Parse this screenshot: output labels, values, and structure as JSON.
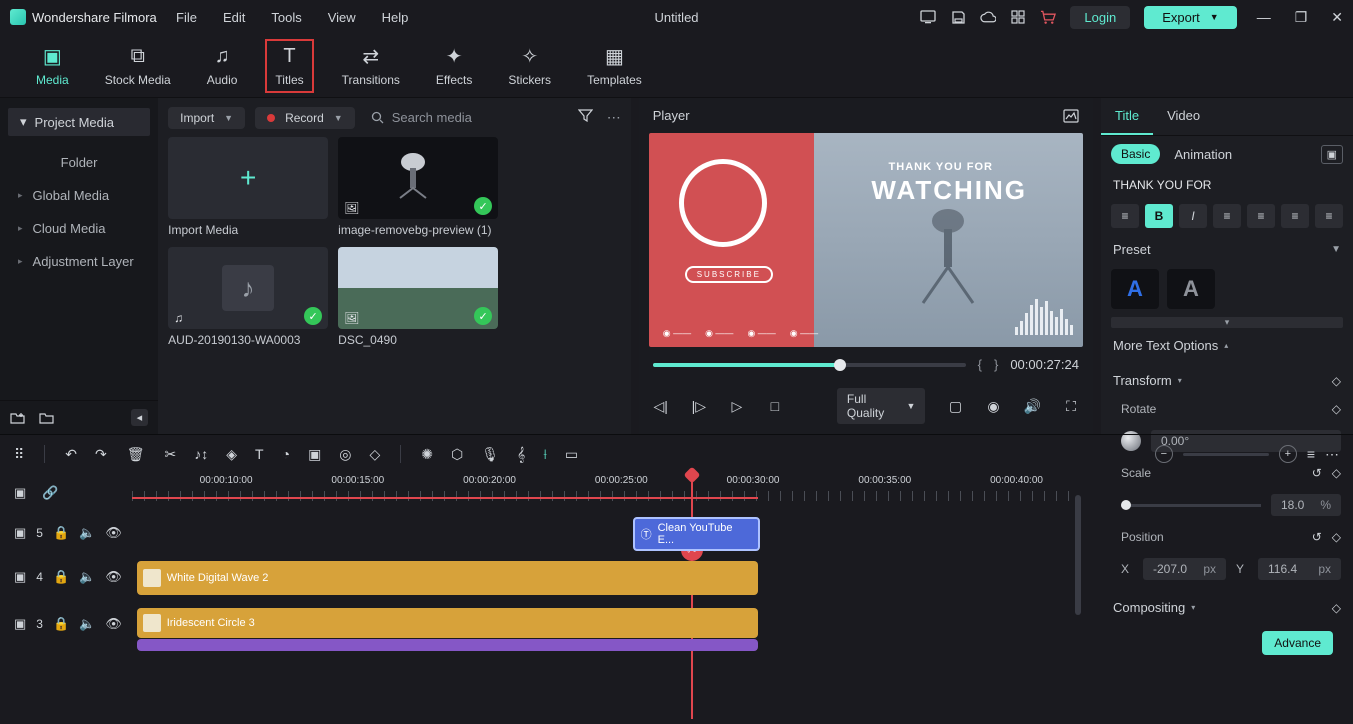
{
  "app": {
    "name": "Wondershare Filmora",
    "title": "Untitled"
  },
  "menu": {
    "file": "File",
    "edit": "Edit",
    "tools": "Tools",
    "view": "View",
    "help": "Help"
  },
  "titlebar": {
    "login": "Login",
    "export": "Export"
  },
  "tabs": {
    "media": "Media",
    "stock": "Stock Media",
    "audio": "Audio",
    "titles": "Titles",
    "transitions": "Transitions",
    "effects": "Effects",
    "stickers": "Stickers",
    "templates": "Templates"
  },
  "sidebar": {
    "project": "Project Media",
    "folder": "Folder",
    "global": "Global Media",
    "cloud": "Cloud Media",
    "adjust": "Adjustment Layer"
  },
  "midbar": {
    "import": "Import",
    "record": "Record",
    "search_placeholder": "Search media"
  },
  "thumbs": {
    "import_media": "Import Media",
    "t2": "image-removebg-preview (1)",
    "t3": "AUD-20190130-WA0003",
    "t4": "DSC_0490"
  },
  "player": {
    "label": "Player",
    "tc": "00:00:27:24",
    "quality": "Full Quality",
    "overlay": {
      "thank": "THANK YOU FOR",
      "watching": "WATCHING",
      "subscribe": "SUBSCRIBE"
    }
  },
  "right": {
    "tabs": {
      "title": "Title",
      "video": "Video"
    },
    "subtabs": {
      "basic": "Basic",
      "animation": "Animation"
    },
    "heading": "THANK YOU FOR",
    "preset": "Preset",
    "more": "More Text Options",
    "transform": "Transform",
    "rotate": "Rotate",
    "rotate_val": "0.00°",
    "scale": "Scale",
    "scale_val": "18.0",
    "scale_unit": "%",
    "position": "Position",
    "pos_x_label": "X",
    "pos_x": "-207.0",
    "pos_x_unit": "px",
    "pos_y_label": "Y",
    "pos_y": "116.4",
    "pos_y_unit": "px",
    "compositing": "Compositing",
    "advance": "Advance"
  },
  "ruler": {
    "ticks": [
      "00:00:10:00",
      "00:00:15:00",
      "00:00:20:00",
      "00:00:25:00",
      "00:00:30:00",
      "00:00:35:00",
      "00:00:40:00"
    ]
  },
  "tracks": {
    "t5": "5",
    "t4": "4",
    "t3": "3",
    "clip1": "Clean YouTube E...",
    "clip2": "White  Digital Wave 2",
    "clip3": "Iridescent Circle 3"
  }
}
